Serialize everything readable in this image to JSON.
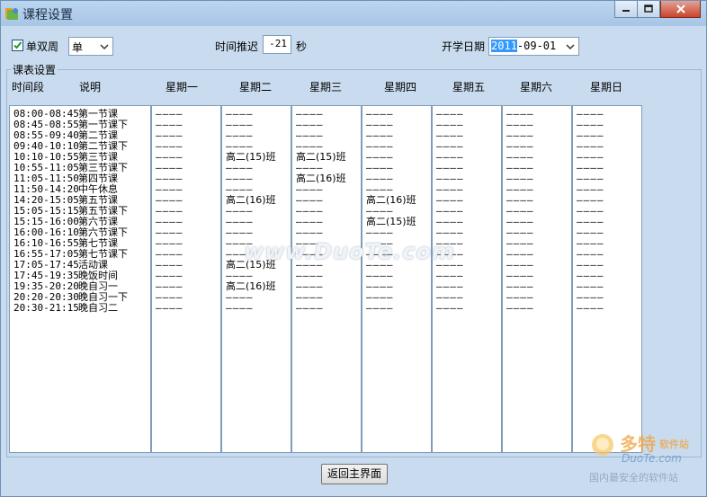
{
  "window": {
    "title": "课程设置"
  },
  "toolbar": {
    "week_mode_label": "单双周",
    "week_mode_checked": true,
    "week_mode_value": "单",
    "delay_label": "时间推迟",
    "delay_value": "-21",
    "delay_unit": "秒",
    "start_date_label": "开学日期",
    "start_date_year": "2011",
    "start_date_rest": "-09-01"
  },
  "group": {
    "label": "课表设置"
  },
  "headers": [
    "时间段",
    "说明",
    "星期一",
    "星期二",
    "星期三",
    "星期四",
    "星期五",
    "星期六",
    "星期日"
  ],
  "slots": [
    {
      "time": "08:00-08:45",
      "desc": "第一节课"
    },
    {
      "time": "08:45-08:55",
      "desc": "第一节课下"
    },
    {
      "time": "08:55-09:40",
      "desc": "第二节课"
    },
    {
      "time": "09:40-10:10",
      "desc": "第二节课下"
    },
    {
      "time": "10:10-10:55",
      "desc": "第三节课"
    },
    {
      "time": "10:55-11:05",
      "desc": "第三节课下"
    },
    {
      "time": "11:05-11:50",
      "desc": "第四节课"
    },
    {
      "time": "11:50-14:20",
      "desc": "中午休息"
    },
    {
      "time": "14:20-15:05",
      "desc": "第五节课"
    },
    {
      "time": "15:05-15:15",
      "desc": "第五节课下"
    },
    {
      "time": "15:15-16:00",
      "desc": "第六节课"
    },
    {
      "time": "16:00-16:10",
      "desc": "第六节课下"
    },
    {
      "time": "16:10-16:55",
      "desc": "第七节课"
    },
    {
      "time": "16:55-17:05",
      "desc": "第七节课下"
    },
    {
      "time": "17:05-17:45",
      "desc": "活动课"
    },
    {
      "time": "17:45-19:35",
      "desc": "晚饭时间"
    },
    {
      "time": "19:35-20:20",
      "desc": "晚自习一"
    },
    {
      "time": "20:20-20:30",
      "desc": "晚自习一下"
    },
    {
      "time": "20:30-21:15",
      "desc": "晚自习二"
    }
  ],
  "days": [
    {
      "name": "星期一",
      "rows": 19,
      "entries": []
    },
    {
      "name": "星期二",
      "rows": 19,
      "entries": [
        {
          "row": 4,
          "text": "高二(15)班"
        },
        {
          "row": 8,
          "text": "高二(16)班"
        },
        {
          "row": 14,
          "text": "高二(15)班"
        },
        {
          "row": 16,
          "text": "高二(16)班"
        }
      ]
    },
    {
      "name": "星期三",
      "rows": 19,
      "entries": [
        {
          "row": 4,
          "text": "高二(15)班"
        },
        {
          "row": 6,
          "text": "高二(16)班"
        }
      ]
    },
    {
      "name": "星期四",
      "rows": 19,
      "entries": [
        {
          "row": 8,
          "text": "高二(16)班"
        },
        {
          "row": 10,
          "text": "高二(15)班"
        }
      ]
    },
    {
      "name": "星期五",
      "rows": 19,
      "entries": []
    },
    {
      "name": "星期六",
      "rows": 19,
      "entries": []
    },
    {
      "name": "星期日",
      "rows": 19,
      "entries": []
    }
  ],
  "empty_marker": "————",
  "footer": {
    "back_label": "返回主界面"
  },
  "watermark": {
    "main": "www.DuoTe.com",
    "brand": "多特",
    "brand_suffix": "软件站",
    "site": "DuoTe.com",
    "slogan": "国内最安全的软件站"
  },
  "colors": {
    "window_bg": "#c9dcef",
    "titlebar": "#a7c5e6",
    "list_bg": "#ffffff",
    "border": "#7f9db9",
    "selection": "#3399ff"
  }
}
